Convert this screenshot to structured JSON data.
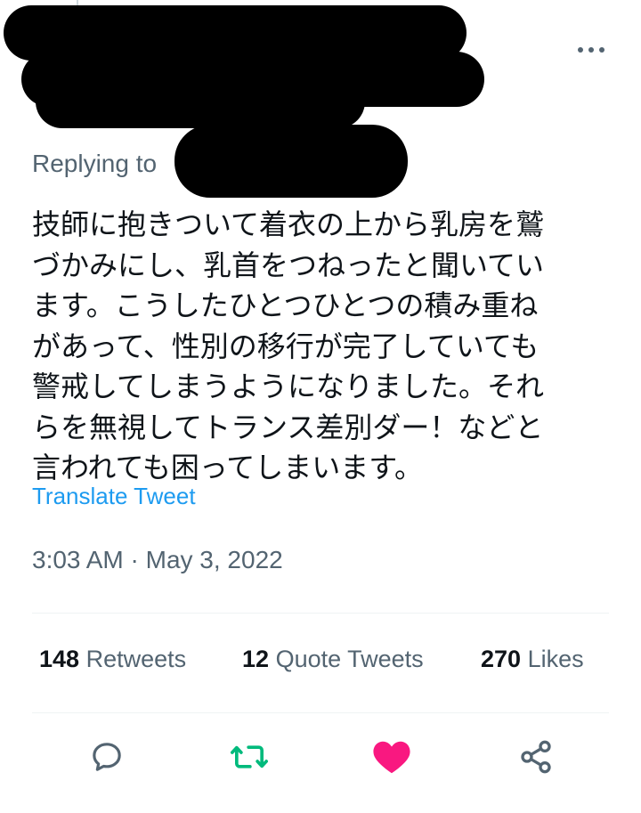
{
  "tweet": {
    "replying_to_label": "Replying to",
    "text": "技師に抱きついて着衣の上から乳房を鷲\nづかみにし、乳首をつねったと聞いてい\nます。こうしたひとつひとつの積み重ね\nがあって、性別の移行が完了していても\n警戒してしまうようになりました。それ\nらを無視してトランス差別ダー！などと\n言われても困ってしまいます。",
    "translate_label": "Translate Tweet",
    "timestamp": "3:03 AM · May 3, 2022"
  },
  "stats": {
    "retweets": {
      "count": "148",
      "label": "Retweets"
    },
    "quote_tweets": {
      "count": "12",
      "label": "Quote Tweets"
    },
    "likes": {
      "count": "270",
      "label": "Likes"
    }
  },
  "actions": {
    "reply_icon": "reply-icon",
    "retweet_icon": "retweet-icon",
    "like_icon": "heart-icon",
    "share_icon": "share-icon"
  },
  "colors": {
    "accent": "#1d9bf0",
    "retweet_green": "#00ba7c",
    "like_pink": "#f91880",
    "secondary_text": "#536471",
    "redaction": "#000000"
  }
}
